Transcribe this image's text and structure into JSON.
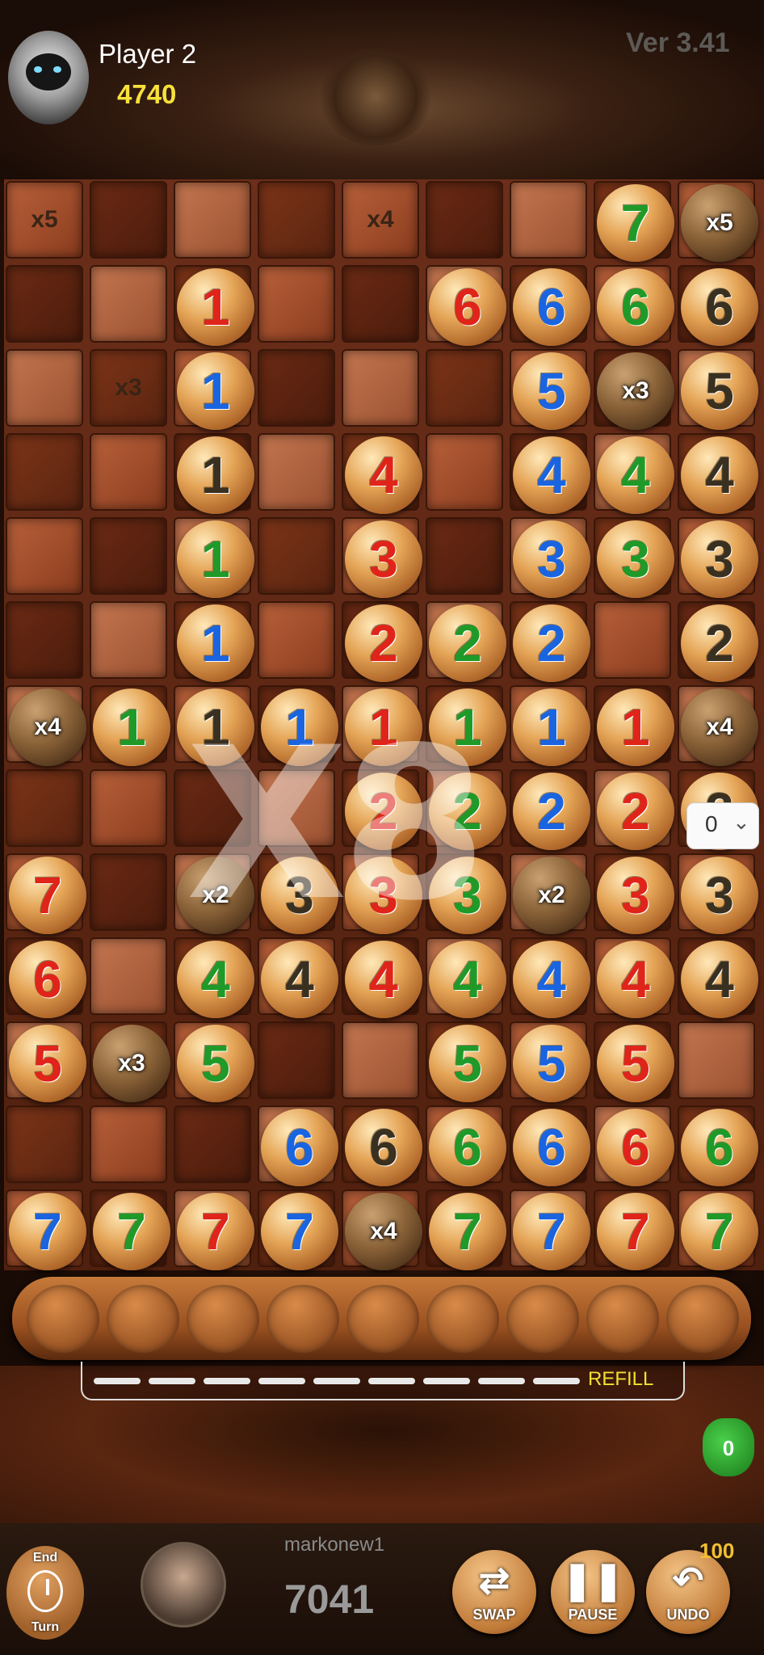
{
  "header": {
    "player_name": "Player 2",
    "player_score": "4740",
    "version": "Ver 3.41"
  },
  "board": {
    "columns": 9,
    "rows": 13,
    "cell_multipliers": [
      {
        "row": 0,
        "col": 0,
        "label": "x5"
      },
      {
        "row": 0,
        "col": 4,
        "label": "x4"
      },
      {
        "row": 2,
        "col": 1,
        "label": "x3"
      }
    ],
    "balls": [
      {
        "row": 0,
        "col": 7,
        "num": "7",
        "color": "green"
      },
      {
        "row": 0,
        "col": 8,
        "num": "",
        "color": "black",
        "mult": "x5",
        "dark": true
      },
      {
        "row": 1,
        "col": 2,
        "num": "1",
        "color": "red"
      },
      {
        "row": 1,
        "col": 5,
        "num": "6",
        "color": "red"
      },
      {
        "row": 1,
        "col": 6,
        "num": "6",
        "color": "blue"
      },
      {
        "row": 1,
        "col": 7,
        "num": "6",
        "color": "green"
      },
      {
        "row": 1,
        "col": 8,
        "num": "6",
        "color": "black"
      },
      {
        "row": 2,
        "col": 2,
        "num": "1",
        "color": "blue"
      },
      {
        "row": 2,
        "col": 6,
        "num": "5",
        "color": "blue"
      },
      {
        "row": 2,
        "col": 7,
        "num": "",
        "color": "green",
        "mult": "x3",
        "dark": true
      },
      {
        "row": 2,
        "col": 8,
        "num": "5",
        "color": "black"
      },
      {
        "row": 3,
        "col": 2,
        "num": "1",
        "color": "black"
      },
      {
        "row": 3,
        "col": 4,
        "num": "4",
        "color": "red"
      },
      {
        "row": 3,
        "col": 6,
        "num": "4",
        "color": "blue"
      },
      {
        "row": 3,
        "col": 7,
        "num": "4",
        "color": "green"
      },
      {
        "row": 3,
        "col": 8,
        "num": "4",
        "color": "black"
      },
      {
        "row": 4,
        "col": 2,
        "num": "1",
        "color": "green"
      },
      {
        "row": 4,
        "col": 4,
        "num": "3",
        "color": "red"
      },
      {
        "row": 4,
        "col": 6,
        "num": "3",
        "color": "blue"
      },
      {
        "row": 4,
        "col": 7,
        "num": "3",
        "color": "green"
      },
      {
        "row": 4,
        "col": 8,
        "num": "3",
        "color": "black"
      },
      {
        "row": 5,
        "col": 2,
        "num": "1",
        "color": "blue"
      },
      {
        "row": 5,
        "col": 4,
        "num": "2",
        "color": "red"
      },
      {
        "row": 5,
        "col": 5,
        "num": "2",
        "color": "green"
      },
      {
        "row": 5,
        "col": 6,
        "num": "2",
        "color": "blue"
      },
      {
        "row": 5,
        "col": 8,
        "num": "2",
        "color": "black"
      },
      {
        "row": 6,
        "col": 0,
        "num": "",
        "color": "red",
        "mult": "x4",
        "dark": true
      },
      {
        "row": 6,
        "col": 1,
        "num": "1",
        "color": "green"
      },
      {
        "row": 6,
        "col": 2,
        "num": "1",
        "color": "black"
      },
      {
        "row": 6,
        "col": 3,
        "num": "1",
        "color": "blue"
      },
      {
        "row": 6,
        "col": 4,
        "num": "1",
        "color": "red"
      },
      {
        "row": 6,
        "col": 5,
        "num": "1",
        "color": "green"
      },
      {
        "row": 6,
        "col": 6,
        "num": "1",
        "color": "blue"
      },
      {
        "row": 6,
        "col": 7,
        "num": "1",
        "color": "red"
      },
      {
        "row": 6,
        "col": 8,
        "num": "",
        "color": "black",
        "mult": "x4",
        "dark": true
      },
      {
        "row": 7,
        "col": 4,
        "num": "2",
        "color": "red"
      },
      {
        "row": 7,
        "col": 5,
        "num": "2",
        "color": "green"
      },
      {
        "row": 7,
        "col": 6,
        "num": "2",
        "color": "blue"
      },
      {
        "row": 7,
        "col": 7,
        "num": "2",
        "color": "red"
      },
      {
        "row": 7,
        "col": 8,
        "num": "2",
        "color": "black"
      },
      {
        "row": 8,
        "col": 0,
        "num": "7",
        "color": "red"
      },
      {
        "row": 8,
        "col": 2,
        "num": "",
        "color": "green",
        "mult": "x2",
        "dark": true
      },
      {
        "row": 8,
        "col": 3,
        "num": "3",
        "color": "black"
      },
      {
        "row": 8,
        "col": 4,
        "num": "3",
        "color": "red"
      },
      {
        "row": 8,
        "col": 5,
        "num": "3",
        "color": "green"
      },
      {
        "row": 8,
        "col": 6,
        "num": "",
        "color": "blue",
        "mult": "x2",
        "dark": true
      },
      {
        "row": 8,
        "col": 7,
        "num": "3",
        "color": "red"
      },
      {
        "row": 8,
        "col": 8,
        "num": "3",
        "color": "black"
      },
      {
        "row": 9,
        "col": 0,
        "num": "6",
        "color": "red"
      },
      {
        "row": 9,
        "col": 2,
        "num": "4",
        "color": "green"
      },
      {
        "row": 9,
        "col": 3,
        "num": "4",
        "color": "black"
      },
      {
        "row": 9,
        "col": 4,
        "num": "4",
        "color": "red"
      },
      {
        "row": 9,
        "col": 5,
        "num": "4",
        "color": "green"
      },
      {
        "row": 9,
        "col": 6,
        "num": "4",
        "color": "blue"
      },
      {
        "row": 9,
        "col": 7,
        "num": "4",
        "color": "red"
      },
      {
        "row": 9,
        "col": 8,
        "num": "4",
        "color": "black"
      },
      {
        "row": 10,
        "col": 0,
        "num": "5",
        "color": "red"
      },
      {
        "row": 10,
        "col": 1,
        "num": "",
        "color": "black",
        "mult": "x3",
        "dark": true
      },
      {
        "row": 10,
        "col": 2,
        "num": "5",
        "color": "green"
      },
      {
        "row": 10,
        "col": 5,
        "num": "5",
        "color": "green"
      },
      {
        "row": 10,
        "col": 6,
        "num": "5",
        "color": "blue"
      },
      {
        "row": 10,
        "col": 7,
        "num": "5",
        "color": "red"
      },
      {
        "row": 11,
        "col": 3,
        "num": "6",
        "color": "blue"
      },
      {
        "row": 11,
        "col": 4,
        "num": "6",
        "color": "black"
      },
      {
        "row": 11,
        "col": 5,
        "num": "6",
        "color": "green"
      },
      {
        "row": 11,
        "col": 6,
        "num": "6",
        "color": "blue"
      },
      {
        "row": 11,
        "col": 7,
        "num": "6",
        "color": "red"
      },
      {
        "row": 11,
        "col": 8,
        "num": "6",
        "color": "green"
      },
      {
        "row": 12,
        "col": 0,
        "num": "7",
        "color": "blue"
      },
      {
        "row": 12,
        "col": 1,
        "num": "7",
        "color": "green"
      },
      {
        "row": 12,
        "col": 2,
        "num": "7",
        "color": "red"
      },
      {
        "row": 12,
        "col": 3,
        "num": "7",
        "color": "blue"
      },
      {
        "row": 12,
        "col": 4,
        "num": "",
        "color": "black",
        "mult": "x4",
        "dark": true
      },
      {
        "row": 12,
        "col": 5,
        "num": "7",
        "color": "green"
      },
      {
        "row": 12,
        "col": 6,
        "num": "7",
        "color": "blue"
      },
      {
        "row": 12,
        "col": 7,
        "num": "7",
        "color": "red"
      },
      {
        "row": 12,
        "col": 8,
        "num": "7",
        "color": "green"
      }
    ],
    "overlay_multiplier": "X8"
  },
  "side_select": {
    "value": "0"
  },
  "tray": {
    "slots": 9
  },
  "refill": {
    "segments": 9,
    "label": "REFILL"
  },
  "bag": {
    "count": "0"
  },
  "footer": {
    "end_turn_top": "End",
    "end_turn_bottom": "Turn",
    "player_name": "markonew1",
    "player_score": "7041",
    "swap_label": "SWAP",
    "pause_label": "PAUSE",
    "undo_label": "UNDO",
    "undo_count": "100"
  },
  "colors": {
    "red": "#e0241a",
    "blue": "#1a64e0",
    "green": "#1f9a28",
    "black": "#3a3020",
    "score_yellow": "#f7e13a",
    "refill_yellow": "#f2e030"
  }
}
